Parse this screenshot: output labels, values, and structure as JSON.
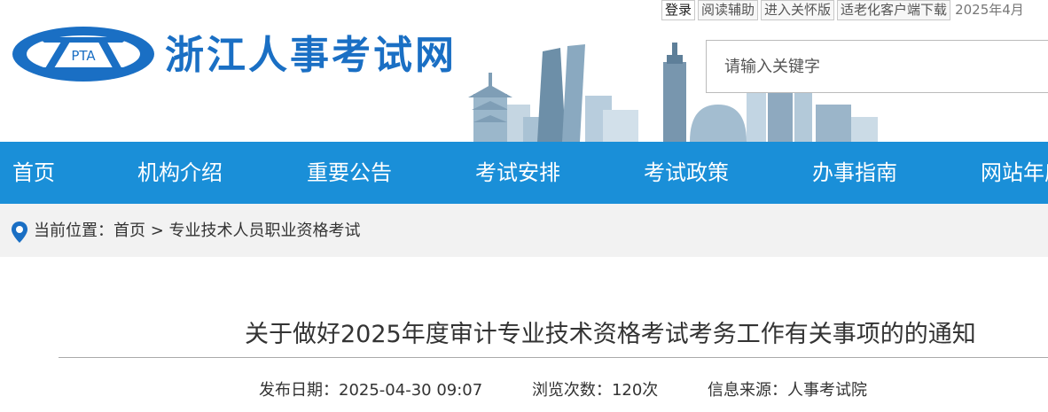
{
  "topbar": {
    "login": "登录",
    "reading_aid": "阅读辅助",
    "care_mode": "进入关怀版",
    "elderly_app": "适老化客户端下载",
    "date": "2025年4月"
  },
  "header": {
    "logo_text": "PTA",
    "site_title": "浙江人事考试网",
    "search_placeholder": "请输入关键字"
  },
  "nav": {
    "items": [
      {
        "label": "首页"
      },
      {
        "label": "机构介绍"
      },
      {
        "label": "重要公告"
      },
      {
        "label": "考试安排"
      },
      {
        "label": "考试政策"
      },
      {
        "label": "办事指南"
      },
      {
        "label": "网站年度"
      }
    ]
  },
  "breadcrumb": {
    "prefix": "当前位置：",
    "home": "首页",
    "separator": " > ",
    "current": "专业技术人员职业资格考试"
  },
  "article": {
    "title": "关于做好2025年度审计专业技术资格考试考务工作有关事项的的通知",
    "publish_label": "发布日期：",
    "publish_date": "2025-04-30 09:07",
    "views_label": "浏览次数：",
    "views": "120次",
    "source_label": "信息来源：",
    "source": "人事考试院"
  },
  "colors": {
    "brand_blue": "#1a6fc4",
    "nav_blue": "#1a8fd8",
    "crumb_bg": "#f2f2f2"
  }
}
